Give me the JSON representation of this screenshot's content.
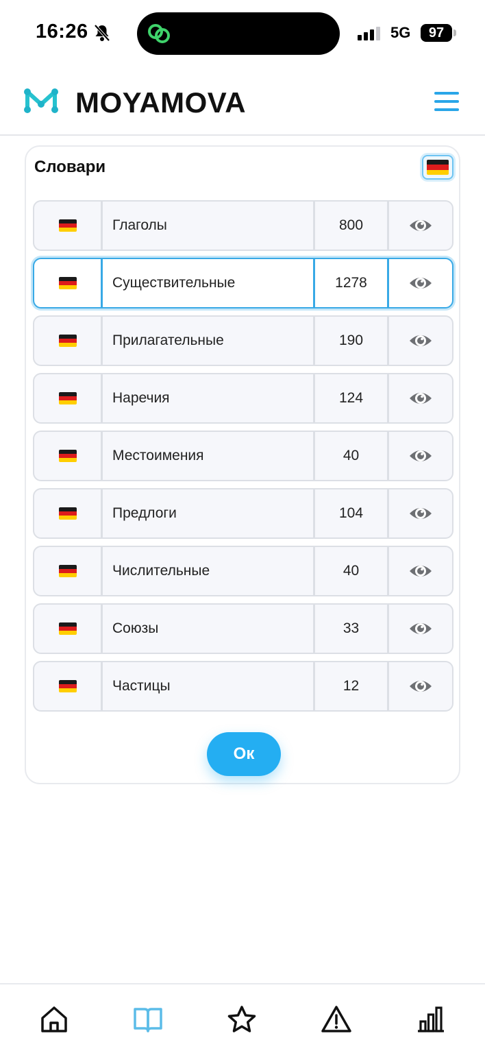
{
  "status_bar": {
    "time": "16:26",
    "network": "5G",
    "battery": "97"
  },
  "header": {
    "logo_text": "MOYAMOVA",
    "logo_icon": "logo-m-icon",
    "menu_icon": "hamburger-icon"
  },
  "dictionaries": {
    "title": "Словари",
    "language": "de",
    "items": [
      {
        "name": "Глаголы",
        "count": "800",
        "selected": false
      },
      {
        "name": "Существительные",
        "count": "1278",
        "selected": true
      },
      {
        "name": "Прилагательные",
        "count": "190",
        "selected": false
      },
      {
        "name": "Наречия",
        "count": "124",
        "selected": false
      },
      {
        "name": "Местоимения",
        "count": "40",
        "selected": false
      },
      {
        "name": "Предлоги",
        "count": "104",
        "selected": false
      },
      {
        "name": "Числительные",
        "count": "40",
        "selected": false
      },
      {
        "name": "Союзы",
        "count": "33",
        "selected": false
      },
      {
        "name": "Частицы",
        "count": "12",
        "selected": false
      }
    ],
    "ok_label": "Ок"
  },
  "bottom_nav": {
    "items": [
      "home-icon",
      "book-icon",
      "star-icon",
      "warning-icon",
      "stats-icon"
    ],
    "active": "book-icon"
  },
  "colors": {
    "accent": "#24aef2",
    "selected_border": "#38a9e6",
    "row_bg": "#f6f7fb"
  }
}
